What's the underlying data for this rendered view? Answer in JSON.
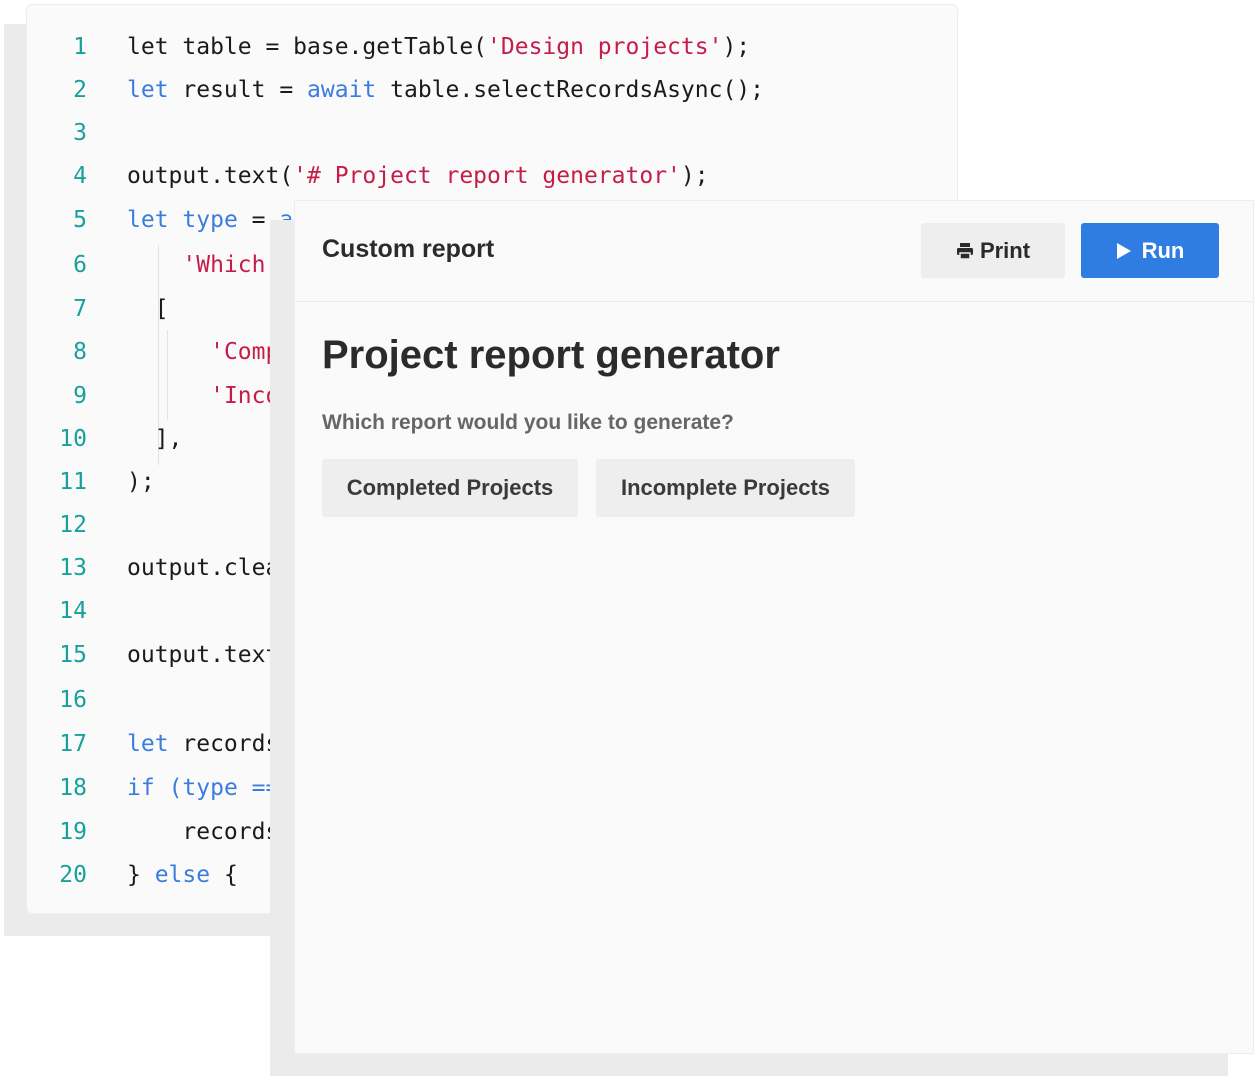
{
  "code_lines": [
    {
      "num": "1",
      "tokens": [
        {
          "t": "plain",
          "v": "let table = base.getTable("
        },
        {
          "t": "str",
          "v": "'Design projects'"
        },
        {
          "t": "plain",
          "v": ");"
        }
      ]
    },
    {
      "num": "2",
      "tokens": [
        {
          "t": "kw",
          "v": "let"
        },
        {
          "t": "plain",
          "v": " result = "
        },
        {
          "t": "kw",
          "v": "await"
        },
        {
          "t": "plain",
          "v": " table.selectRecordsAsync();"
        }
      ]
    },
    {
      "num": "3",
      "tokens": []
    },
    {
      "num": "4",
      "tokens": [
        {
          "t": "plain",
          "v": "output.text("
        },
        {
          "t": "str",
          "v": "'# Project report generator'"
        },
        {
          "t": "plain",
          "v": ");"
        }
      ]
    },
    {
      "num": "5",
      "tokens": [
        {
          "t": "kw",
          "v": "let"
        },
        {
          "t": "plain",
          "v": " "
        },
        {
          "t": "kw",
          "v": "type"
        },
        {
          "t": "plain",
          "v": " = "
        },
        {
          "t": "kw",
          "v": "a"
        }
      ]
    },
    {
      "num": "6",
      "tokens": [
        {
          "t": "plain",
          "v": "    "
        },
        {
          "t": "str",
          "v": "'Which r"
        }
      ]
    },
    {
      "num": "7",
      "tokens": [
        {
          "t": "plain",
          "v": "  ["
        }
      ]
    },
    {
      "num": "8",
      "tokens": [
        {
          "t": "plain",
          "v": "      "
        },
        {
          "t": "str",
          "v": "'Comp"
        }
      ]
    },
    {
      "num": "9",
      "tokens": [
        {
          "t": "plain",
          "v": "      "
        },
        {
          "t": "str",
          "v": "'Inco"
        }
      ]
    },
    {
      "num": "10",
      "tokens": [
        {
          "t": "plain",
          "v": "  ],"
        }
      ]
    },
    {
      "num": "11",
      "tokens": [
        {
          "t": "plain",
          "v": ");"
        }
      ]
    },
    {
      "num": "12",
      "tokens": []
    },
    {
      "num": "13",
      "tokens": [
        {
          "t": "plain",
          "v": "output.clear"
        }
      ]
    },
    {
      "num": "14",
      "tokens": []
    },
    {
      "num": "15",
      "tokens": [
        {
          "t": "plain",
          "v": "output.text("
        }
      ]
    },
    {
      "num": "16",
      "tokens": []
    },
    {
      "num": "17",
      "tokens": [
        {
          "t": "kw",
          "v": "let"
        },
        {
          "t": "plain",
          "v": " records"
        }
      ]
    },
    {
      "num": "18",
      "tokens": [
        {
          "t": "kw",
          "v": "if"
        },
        {
          "t": "plain",
          "v": " "
        },
        {
          "t": "kw",
          "v": "(type =="
        }
      ]
    },
    {
      "num": "19",
      "tokens": [
        {
          "t": "plain",
          "v": "    records"
        }
      ]
    },
    {
      "num": "20",
      "tokens": [
        {
          "t": "plain",
          "v": "} "
        },
        {
          "t": "kw",
          "v": "else"
        },
        {
          "t": "plain",
          "v": " {"
        }
      ]
    }
  ],
  "colors": {
    "line_number": "#18a19a",
    "keyword": "#3b7ddd",
    "string": "#c51d4a",
    "run_button": "#2f7de2"
  },
  "report": {
    "title": "Custom report",
    "print_label": "Print",
    "run_label": "Run",
    "heading": "Project report generator",
    "question": "Which report would you like to generate?",
    "choices": [
      "Completed Projects",
      "Incomplete Projects"
    ]
  },
  "icons": {
    "print": "printer-icon",
    "run": "play-icon"
  }
}
